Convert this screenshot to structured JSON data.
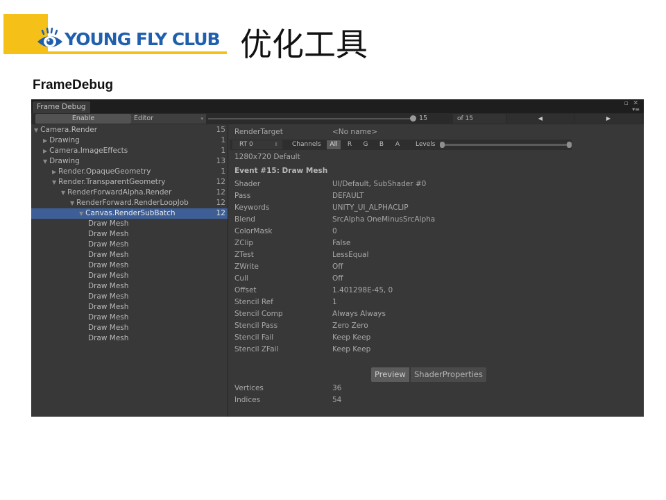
{
  "slide": {
    "logo_text": "YOUNG FLY CLUB",
    "title": "优化工具",
    "subtitle": "FrameDebug"
  },
  "window": {
    "tab_label": "Frame Debug",
    "controls": "▫ ✕",
    "menu_icon": "▾≡",
    "toolbar": {
      "enable_label": "Enable",
      "target_select": "Editor",
      "frame_value": "15",
      "of_frames": "of 15",
      "prev_icon": "◀",
      "next_icon": "▶"
    },
    "tree": [
      {
        "label": "Camera.Render",
        "count": "15",
        "depth": 0,
        "toggle": "open"
      },
      {
        "label": "Drawing",
        "count": "1",
        "depth": 1,
        "toggle": "closed"
      },
      {
        "label": "Camera.ImageEffects",
        "count": "1",
        "depth": 1,
        "toggle": "closed"
      },
      {
        "label": "Drawing",
        "count": "13",
        "depth": 1,
        "toggle": "open"
      },
      {
        "label": "Render.OpaqueGeometry",
        "count": "1",
        "depth": 2,
        "toggle": "closed"
      },
      {
        "label": "Render.TransparentGeometry",
        "count": "12",
        "depth": 2,
        "toggle": "open"
      },
      {
        "label": "RenderForwardAlpha.Render",
        "count": "12",
        "depth": 3,
        "toggle": "open"
      },
      {
        "label": "RenderForward.RenderLoopJob",
        "count": "12",
        "depth": 4,
        "toggle": "open"
      },
      {
        "label": "Canvas.RenderSubBatch",
        "count": "12",
        "depth": 5,
        "toggle": "open",
        "selected": true
      },
      {
        "label": "Draw Mesh",
        "count": "",
        "depth": 6,
        "toggle": "none"
      },
      {
        "label": "Draw Mesh",
        "count": "",
        "depth": 6,
        "toggle": "none"
      },
      {
        "label": "Draw Mesh",
        "count": "",
        "depth": 6,
        "toggle": "none"
      },
      {
        "label": "Draw Mesh",
        "count": "",
        "depth": 6,
        "toggle": "none"
      },
      {
        "label": "Draw Mesh",
        "count": "",
        "depth": 6,
        "toggle": "none"
      },
      {
        "label": "Draw Mesh",
        "count": "",
        "depth": 6,
        "toggle": "none"
      },
      {
        "label": "Draw Mesh",
        "count": "",
        "depth": 6,
        "toggle": "none"
      },
      {
        "label": "Draw Mesh",
        "count": "",
        "depth": 6,
        "toggle": "none"
      },
      {
        "label": "Draw Mesh",
        "count": "",
        "depth": 6,
        "toggle": "none"
      },
      {
        "label": "Draw Mesh",
        "count": "",
        "depth": 6,
        "toggle": "none"
      },
      {
        "label": "Draw Mesh",
        "count": "",
        "depth": 6,
        "toggle": "none"
      },
      {
        "label": "Draw Mesh",
        "count": "",
        "depth": 6,
        "toggle": "none"
      }
    ],
    "details": {
      "render_target_key": "RenderTarget",
      "render_target_value": "<No name>",
      "rt_select": "RT 0",
      "channels_label": "Channels",
      "channels": [
        "All",
        "R",
        "G",
        "B",
        "A"
      ],
      "active_channel": "All",
      "levels_label": "Levels",
      "resolution": "1280x720 Default",
      "event_title": "Event #15: Draw Mesh",
      "properties": [
        {
          "key": "Shader",
          "value": "UI/Default, SubShader #0"
        },
        {
          "key": "Pass",
          "value": "DEFAULT"
        },
        {
          "key": "Keywords",
          "value": "UNITY_UI_ALPHACLIP"
        },
        {
          "key": "Blend",
          "value": "SrcAlpha OneMinusSrcAlpha"
        },
        {
          "key": "ColorMask",
          "value": "0"
        },
        {
          "key": "ZClip",
          "value": "False"
        },
        {
          "key": "ZTest",
          "value": "LessEqual"
        },
        {
          "key": "ZWrite",
          "value": "Off"
        },
        {
          "key": "Cull",
          "value": "Off"
        },
        {
          "key": "Offset",
          "value": "1.401298E-45, 0"
        },
        {
          "key": "Stencil Ref",
          "value": "1"
        },
        {
          "key": "Stencil Comp",
          "value": "Always Always"
        },
        {
          "key": "Stencil Pass",
          "value": "Zero Zero"
        },
        {
          "key": "Stencil Fail",
          "value": "Keep Keep"
        },
        {
          "key": "Stencil ZFail",
          "value": "Keep Keep"
        }
      ],
      "tab_preview": "Preview",
      "tab_shader_props": "ShaderProperties",
      "stats": [
        {
          "key": "Vertices",
          "value": "36"
        },
        {
          "key": "Indices",
          "value": "54"
        }
      ]
    }
  },
  "colors": {
    "accent_yellow": "#f5c018",
    "logo_blue": "#1f5fae",
    "panel_bg": "#383838",
    "selection": "#3e5f96"
  }
}
